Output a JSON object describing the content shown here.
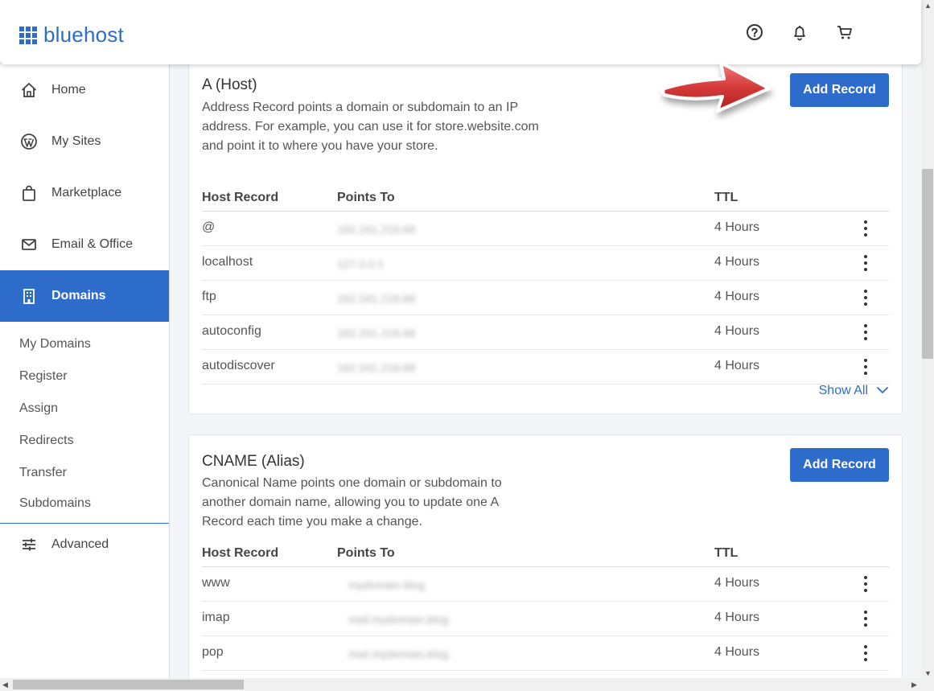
{
  "brand": {
    "name": "bluehost",
    "color": "#2d6ccb"
  },
  "header": {
    "icons": [
      "help-icon",
      "bell-icon",
      "cart-icon"
    ]
  },
  "sidebar": {
    "items": [
      {
        "label": "Home",
        "icon": "home-icon"
      },
      {
        "label": "My Sites",
        "icon": "wordpress-icon"
      },
      {
        "label": "Marketplace",
        "icon": "shopping-bag-icon"
      },
      {
        "label": "Email & Office",
        "icon": "mail-icon"
      },
      {
        "label": "Domains",
        "icon": "building-icon",
        "active": true
      }
    ],
    "sub_items": [
      "My Domains",
      "Register",
      "Assign",
      "Redirects",
      "Transfer",
      "Subdomains"
    ],
    "advanced": {
      "label": "Advanced",
      "icon": "sliders-icon"
    }
  },
  "a_record": {
    "title": "A (Host)",
    "description": "Address Record points a domain or subdomain to an IP address. For example, you can use it for store.website.com and point it to where you have your store.",
    "add_label": "Add Record",
    "columns": {
      "host": "Host Record",
      "points": "Points To",
      "ttl": "TTL"
    },
    "rows": [
      {
        "host": "@",
        "points": "162.241.216.68",
        "ttl": "4 Hours"
      },
      {
        "host": "localhost",
        "points": "127.0.0.1",
        "ttl": "4 Hours"
      },
      {
        "host": "ftp",
        "points": "162.241.216.68",
        "ttl": "4 Hours"
      },
      {
        "host": "autoconfig",
        "points": "162.241.216.68",
        "ttl": "4 Hours"
      },
      {
        "host": "autodiscover",
        "points": "162.241.216.68",
        "ttl": "4 Hours"
      }
    ],
    "show_all": "Show All"
  },
  "cname_record": {
    "title": "CNAME (Alias)",
    "description": "Canonical Name points one domain or subdomain to another domain name, allowing you to update one A Record each time you make a change.",
    "add_label": "Add Record",
    "columns": {
      "host": "Host Record",
      "points": "Points To",
      "ttl": "TTL"
    },
    "rows": [
      {
        "host": "www",
        "points": "mydomain.blog",
        "ttl": "4 Hours"
      },
      {
        "host": "imap",
        "points": "mail.mydomain.blog",
        "ttl": "4 Hours"
      },
      {
        "host": "pop",
        "points": "mail.mydomain.blog",
        "ttl": "4 Hours"
      }
    ]
  }
}
